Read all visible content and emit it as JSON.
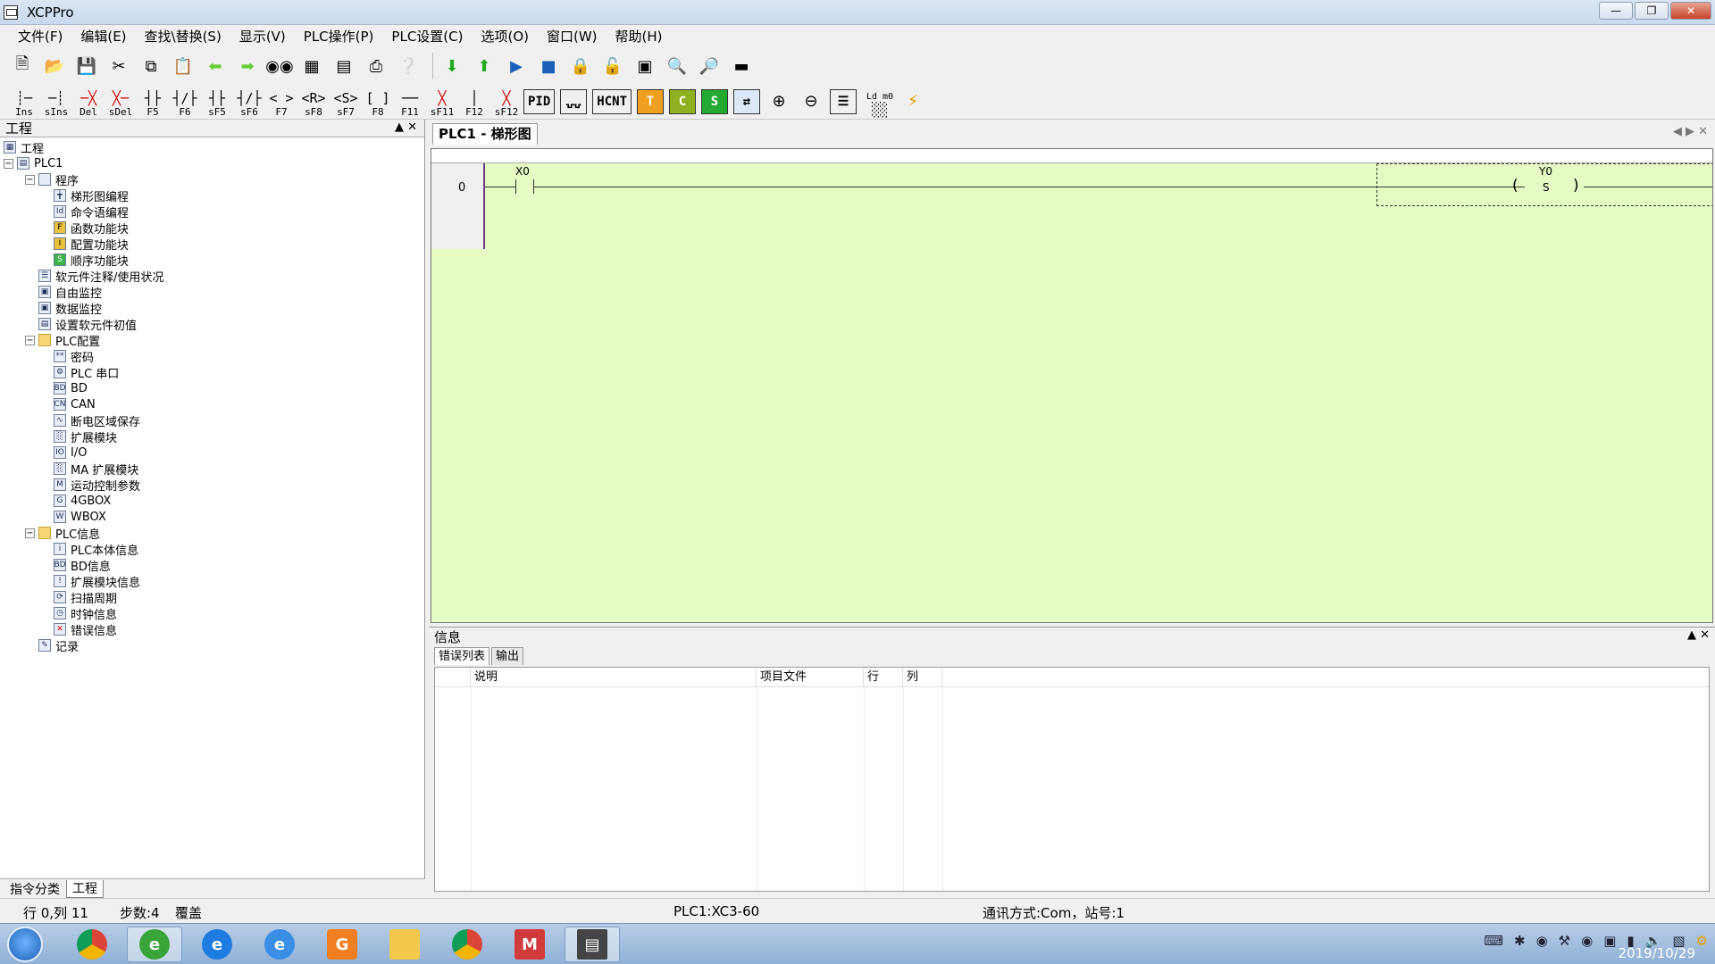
{
  "window": {
    "title": "XCPPro"
  },
  "menu": [
    "文件(F)",
    "编辑(E)",
    "查找\\替换(S)",
    "显示(V)",
    "PLC操作(P)",
    "PLC设置(C)",
    "选项(O)",
    "窗口(W)",
    "帮助(H)"
  ],
  "toolbar2": {
    "ins": "Ins",
    "sins": "sIns",
    "del": "Del",
    "sdel": "sDel",
    "f5": "F5",
    "f6": "F6",
    "sf5": "sF5",
    "sf6": "sF6",
    "f7": "F7",
    "sf8": "sF8",
    "sf7": "sF7",
    "f8": "F8",
    "f11": "F11",
    "sf11": "sF11",
    "f12": "F12",
    "sf12": "sF12",
    "pid": "PID",
    "hcnt": "HCNT",
    "t": "T",
    "c": "C",
    "s": "S",
    "ldm0": "Ld m0"
  },
  "project_panel": {
    "title": "工程",
    "tree": {
      "root": "工程",
      "plc1": "PLC1",
      "program": "程序",
      "ladder": "梯形图编程",
      "command": "命令语编程",
      "func_block": "函数功能块",
      "config_block": "配置功能块",
      "seq_block": "顺序功能块",
      "comments": "软元件注释/使用状况",
      "free_monitor": "自由监控",
      "data_monitor": "数据监控",
      "init_values": "设置软元件初值",
      "plc_config": "PLC配置",
      "password": "密码",
      "serial": "PLC 串口",
      "bd": "BD",
      "can": "CAN",
      "power_save": "断电区域保存",
      "ext_module": "扩展模块",
      "io": "I/O",
      "ma_ext": "MA 扩展模块",
      "motion": "运动控制参数",
      "gbox": "4GBOX",
      "wbox": "WBOX",
      "plc_info": "PLC信息",
      "plc_body": "PLC本体信息",
      "bd_info": "BD信息",
      "ext_info": "扩展模块信息",
      "scan": "扫描周期",
      "clock": "时钟信息",
      "error": "错误信息",
      "record": "记录"
    },
    "bottom_tabs": [
      "指令分类",
      "工程"
    ]
  },
  "editor": {
    "tab": "PLC1 - 梯形图",
    "rung_number": "0",
    "contact": "X0",
    "coil_device": "Y0",
    "coil_type": "S"
  },
  "info_panel": {
    "title": "信息",
    "tabs": [
      "错误列表",
      "输出"
    ],
    "columns": [
      "说明",
      "项目文件",
      "行",
      "列"
    ]
  },
  "status": {
    "position": "行 0,列 11",
    "steps": "步数:4",
    "mode": "覆盖",
    "plc": "PLC1:XC3-60",
    "comm": "通讯方式:Com，站号:1"
  },
  "taskbar": {
    "date": "2019/10/29"
  }
}
